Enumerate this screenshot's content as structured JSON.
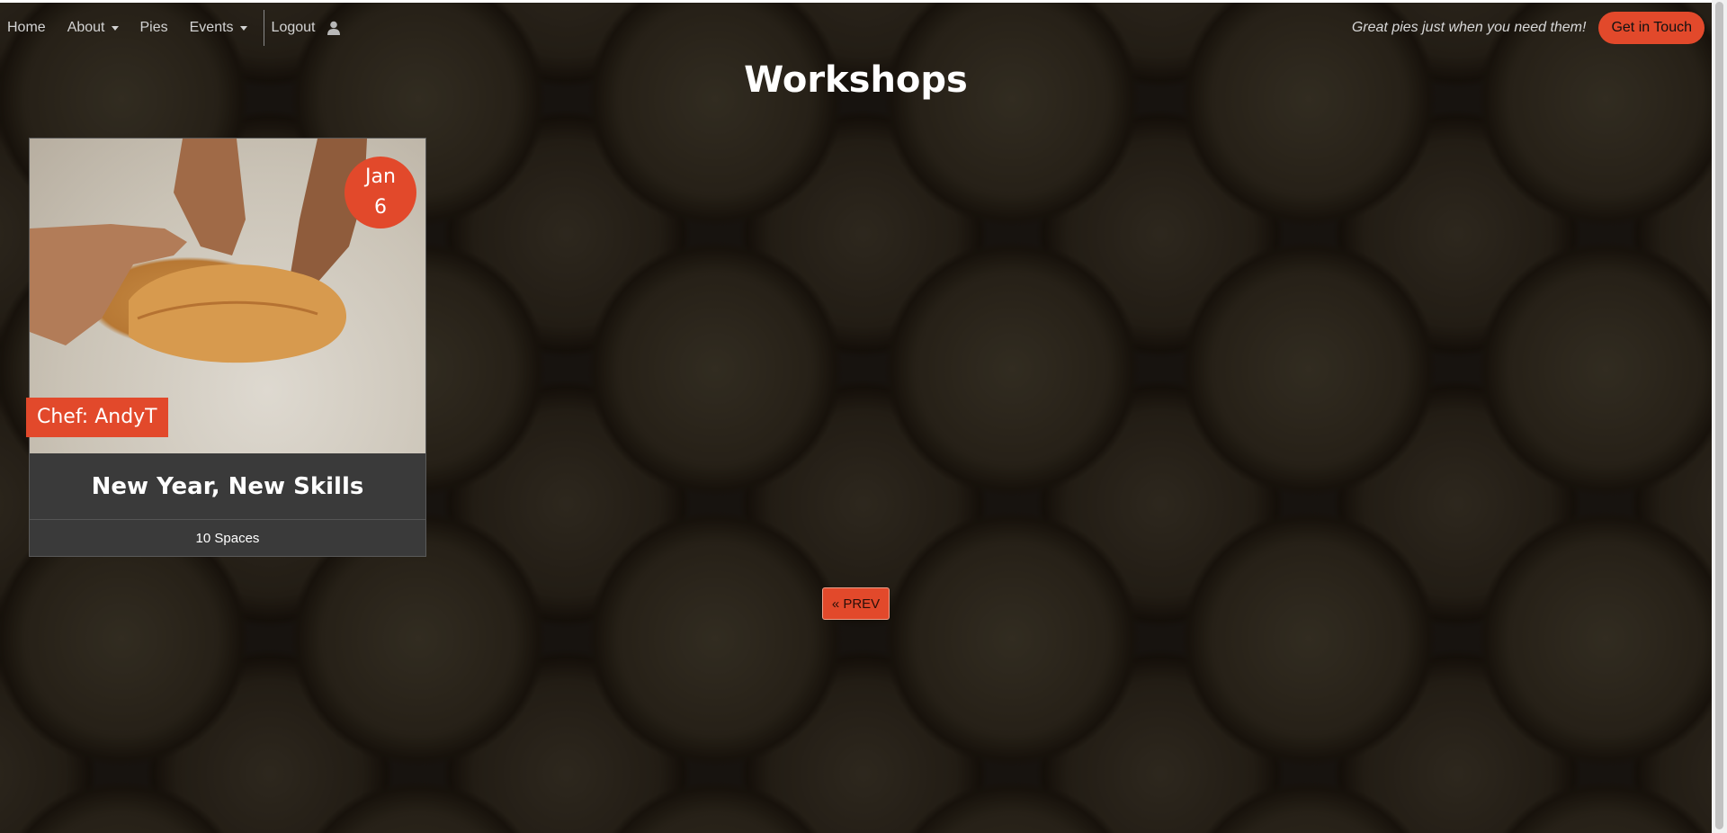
{
  "nav": {
    "items": [
      {
        "label": "Home",
        "has_dropdown": false
      },
      {
        "label": "About",
        "has_dropdown": true
      },
      {
        "label": "Pies",
        "has_dropdown": false
      },
      {
        "label": "Events",
        "has_dropdown": true
      }
    ],
    "logout_label": "Logout",
    "user_icon": "user-icon",
    "tagline": "Great pies just when you need them!",
    "cta_label": "Get in Touch"
  },
  "page": {
    "title": "Workshops"
  },
  "workshops": [
    {
      "date_month": "Jan",
      "date_day": "6",
      "chef": "Chef: AndyT",
      "title": "New Year, New Skills",
      "spaces": "10 Spaces"
    }
  ],
  "pagination": {
    "prev_label": "« PREV"
  },
  "colors": {
    "accent": "#e2492b",
    "card_bg": "#3a3a3a",
    "text_light": "#ffffff"
  }
}
